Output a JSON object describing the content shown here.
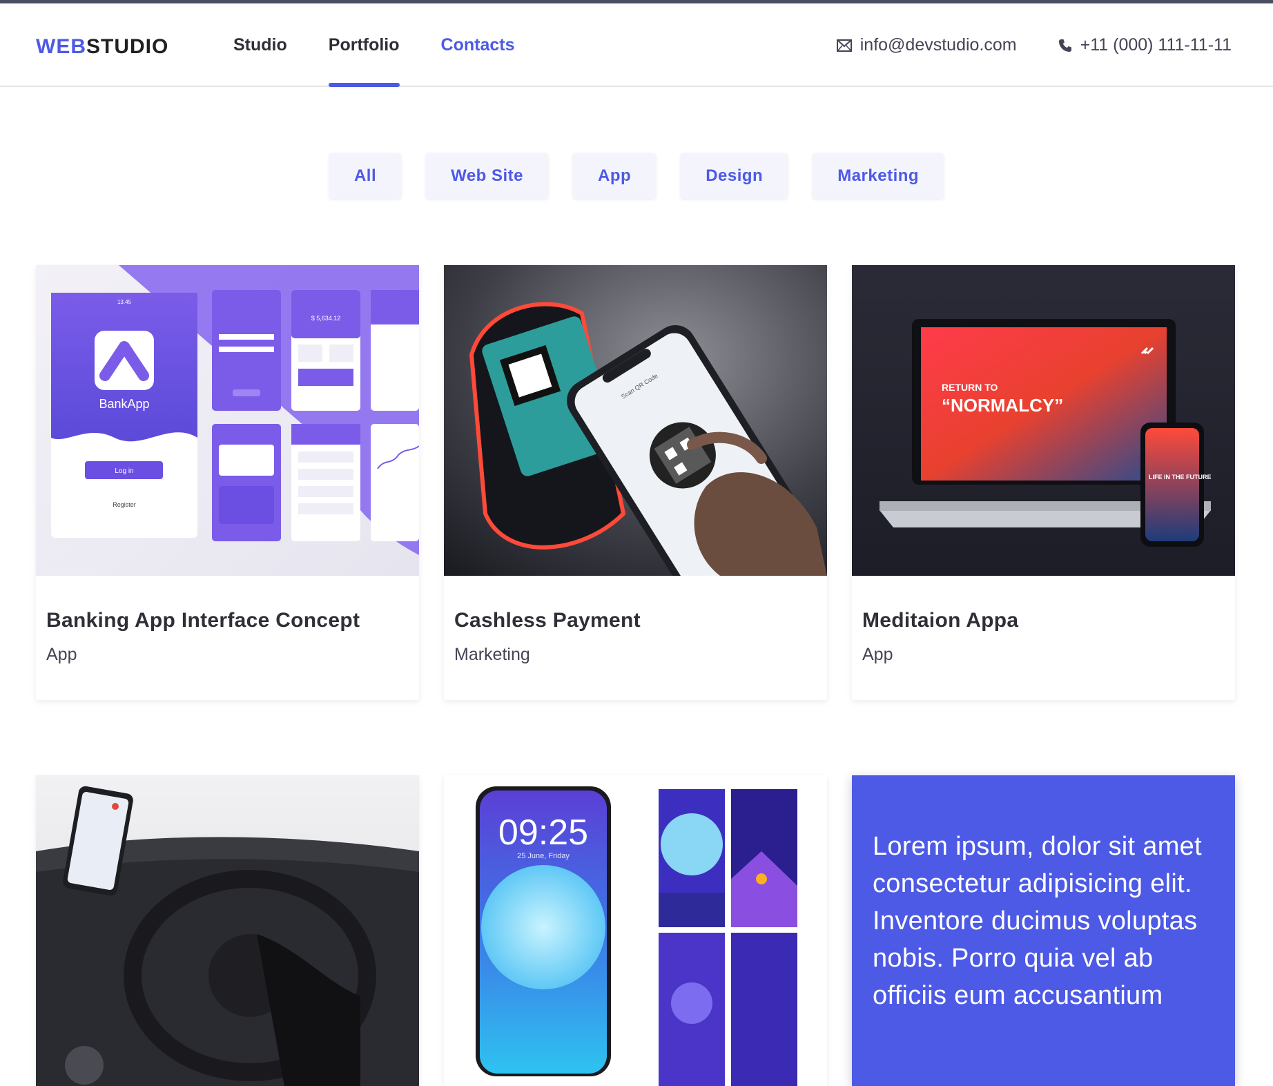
{
  "header": {
    "logo_accent": "WEB",
    "logo_rest": "STUDIO",
    "nav": [
      {
        "label": "Studio"
      },
      {
        "label": "Portfolio"
      },
      {
        "label": "Contacts"
      }
    ],
    "email": "info@devstudio.com",
    "phone": "+11 (000) 111-11-11"
  },
  "filters": [
    "All",
    "Web Site",
    "App",
    "Design",
    "Marketing"
  ],
  "cards": [
    {
      "title": "Banking App Interface Concept",
      "category": "App",
      "image": "banking-app-mockup"
    },
    {
      "title": "Cashless Payment",
      "category": "Marketing",
      "image": "qr-phone-payment"
    },
    {
      "title": "Meditaion Appa",
      "category": "App",
      "image": "laptop-phone-mockup"
    },
    {
      "image": "car-dashboard-phone"
    },
    {
      "image": "moon-phone-wallpapers"
    },
    {
      "overlay_text": "Lorem ipsum, dolor sit amet consectetur adipisicing elit. Inventore ducimus voluptas nobis. Porro quia vel ab officiis eum accusantium"
    }
  ],
  "mockup_text": {
    "bank_app": "BankApp",
    "login": "Log in",
    "register": "Register",
    "balance": "$ 5,634.12",
    "status_time": "13.45",
    "scan": "Scan QR Code",
    "return_to": "RETURN TO",
    "normalcy": "“NORMALCY”",
    "life": "LIFE IN THE FUTURE",
    "clock": "09:25",
    "date": "25 June, Friday"
  },
  "colors": {
    "accent": "#4d5ae5",
    "filter_bg": "#f4f4fd",
    "text_dark": "#2f2f37"
  }
}
